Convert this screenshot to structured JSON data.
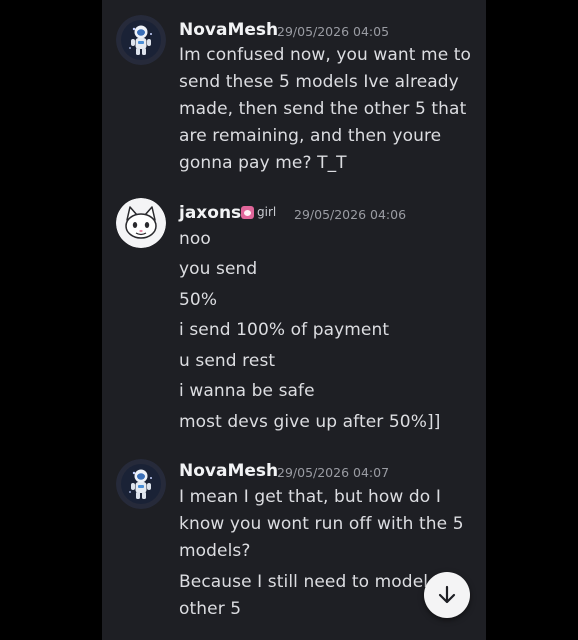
{
  "colors": {
    "panel_bg": "#1e1f24",
    "text": "#dcdde1",
    "muted": "#9a9ca3",
    "tag_pink": "#e0669a"
  },
  "messages": [
    {
      "username": "NovaMesh",
      "timestamp": "29/05/2026 04:05",
      "avatar_icon": "astronaut-icon",
      "lines": [
        "Im confused now, you want me to",
        "send these 5 models Ive already",
        "made, then send the other 5 that",
        "are remaining, and then youre",
        "gonna pay me? T_T"
      ]
    },
    {
      "username": "jaxons",
      "tag": "girl",
      "timestamp": "29/05/2026 04:06",
      "avatar_icon": "cat-icon",
      "lines": [
        "noo",
        "you send",
        "50%",
        "i send 100% of payment",
        "u send rest",
        "i wanna be safe",
        "most devs give up after 50%]]"
      ]
    },
    {
      "username": "NovaMesh",
      "timestamp": "29/05/2026 04:07",
      "avatar_icon": "astronaut-icon",
      "lines": [
        "I mean I get that, but how do I",
        "know you wont run off with the 5",
        "models?",
        "Because I still need to model the",
        "other 5"
      ]
    }
  ],
  "scroll_button_icon": "arrow-down-icon"
}
